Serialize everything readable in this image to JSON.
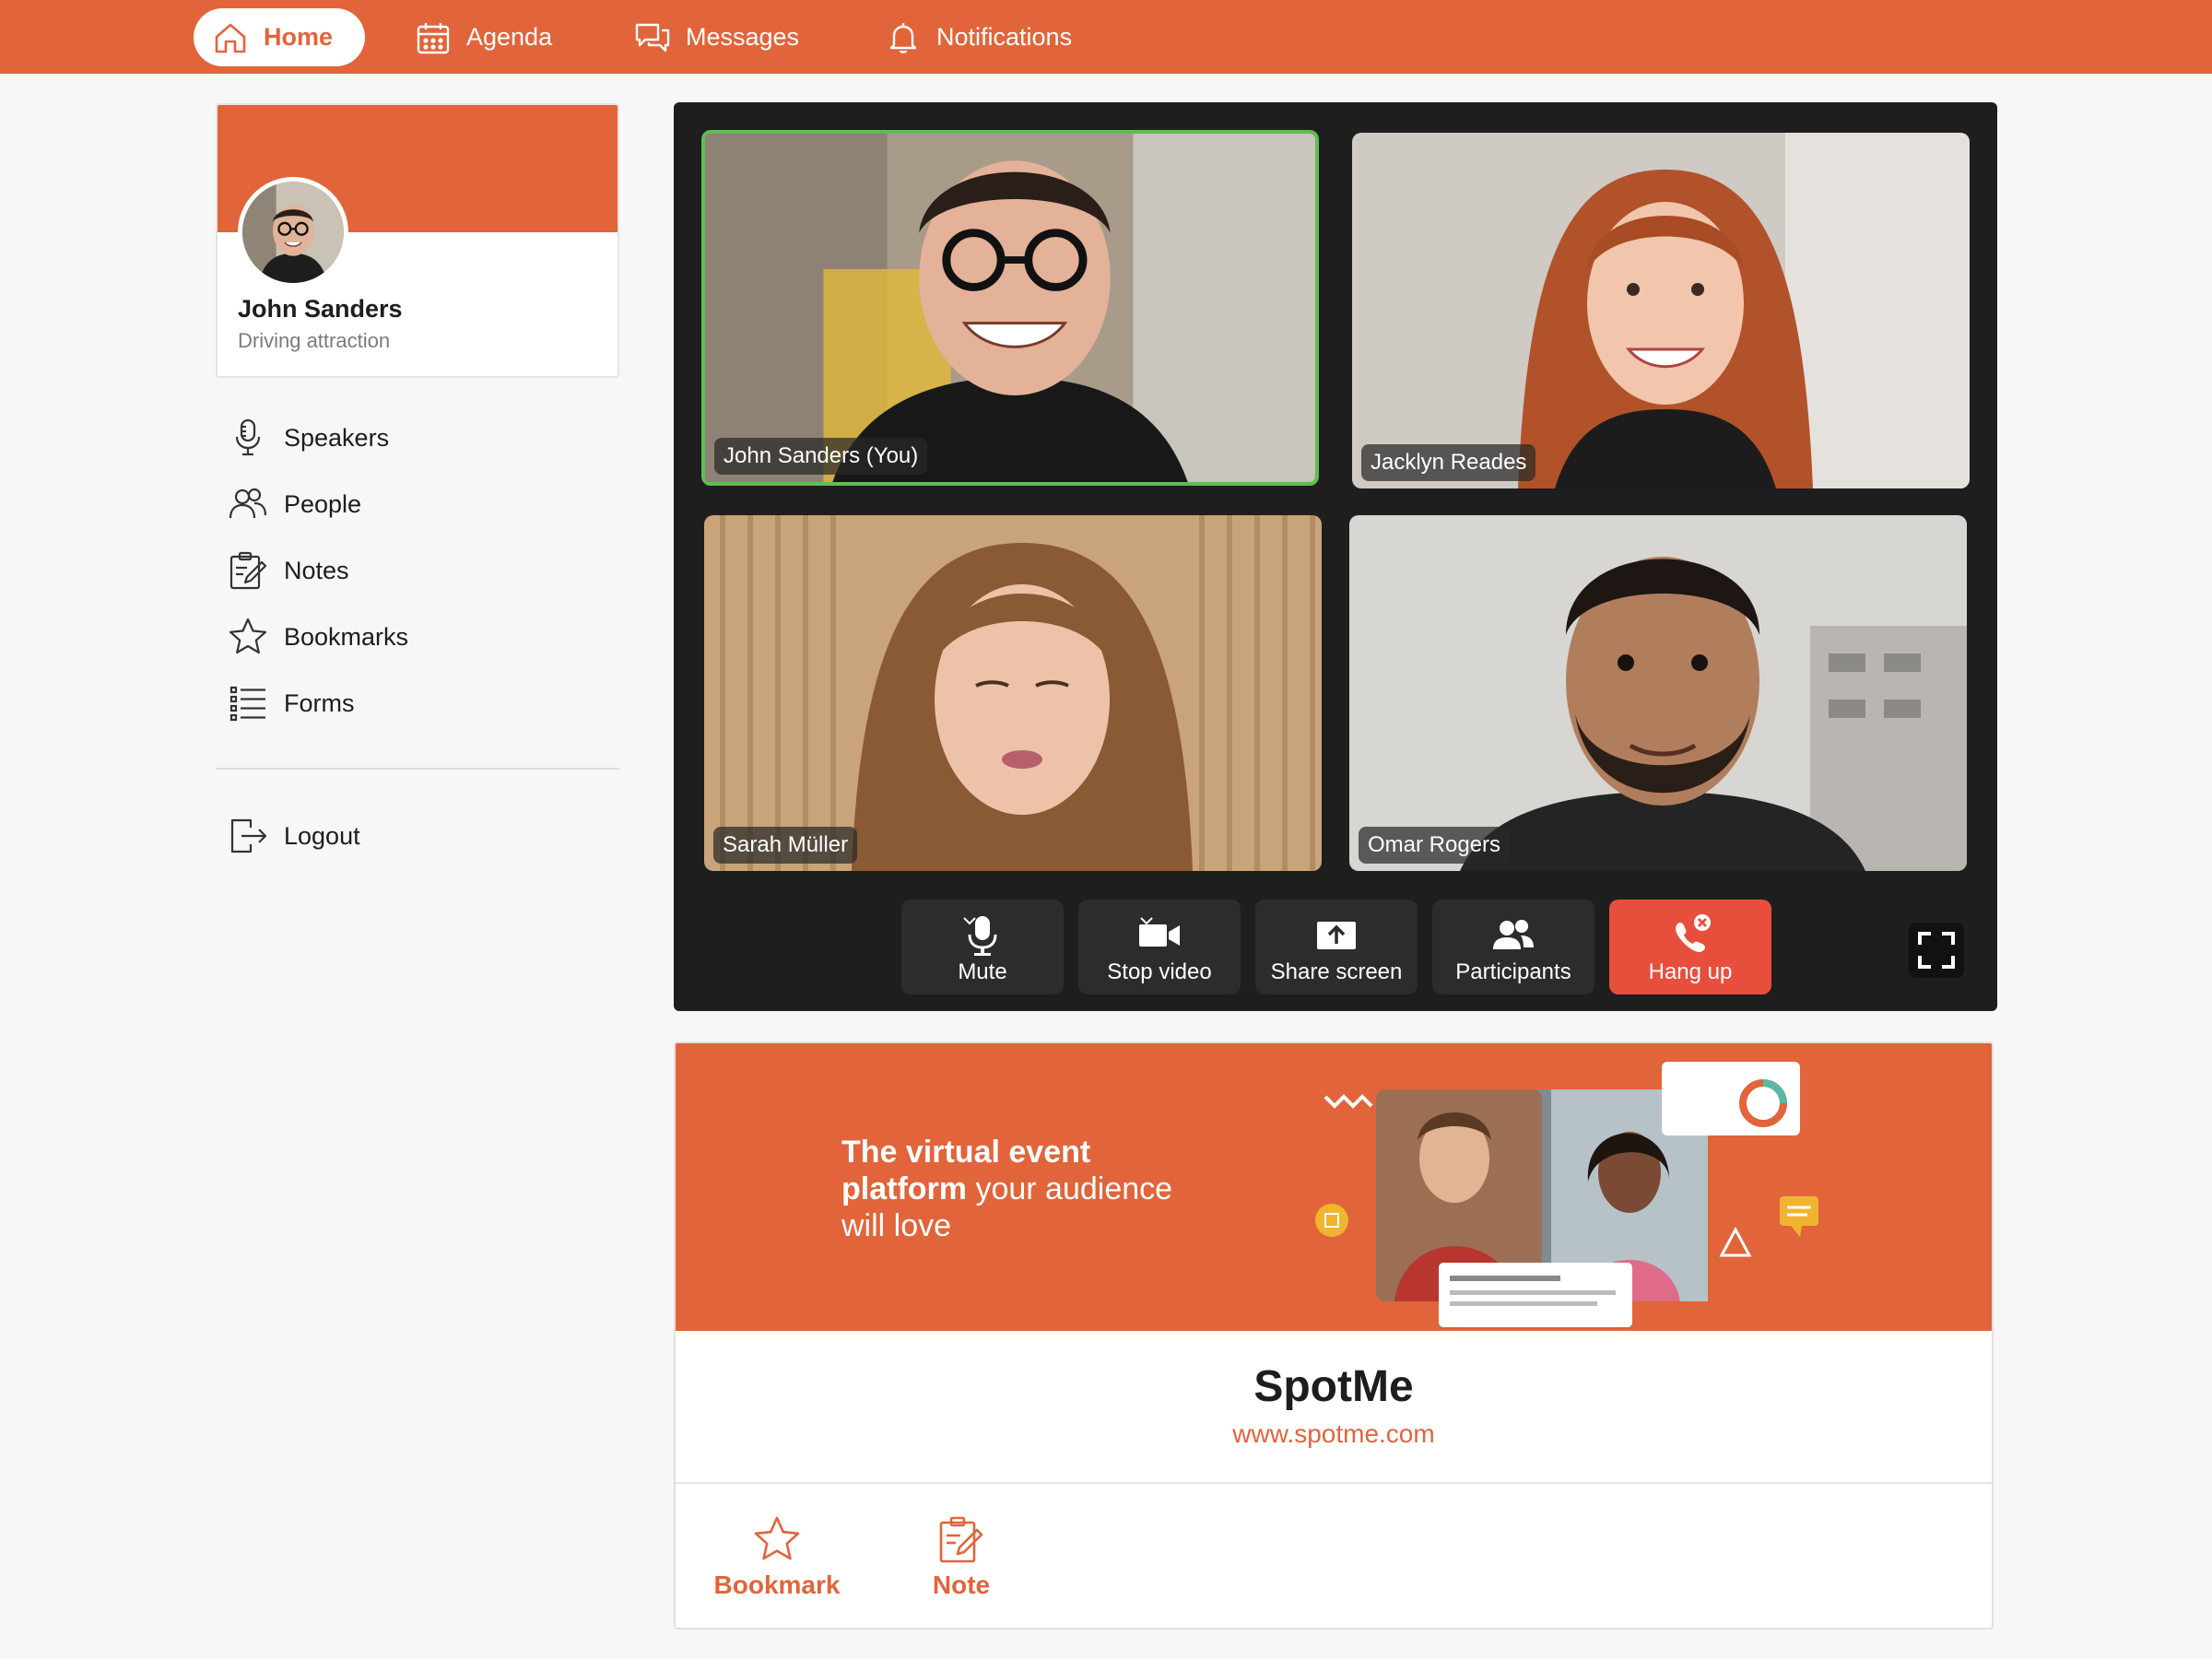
{
  "nav": {
    "home": "Home",
    "agenda": "Agenda",
    "messages": "Messages",
    "notifications": "Notifications"
  },
  "profile": {
    "name": "John Sanders",
    "role": "Driving attraction"
  },
  "menu": {
    "speakers": "Speakers",
    "people": "People",
    "notes": "Notes",
    "bookmarks": "Bookmarks",
    "forms": "Forms",
    "logout": "Logout"
  },
  "call": {
    "participants": [
      {
        "label": "John Sanders (You)",
        "active": true
      },
      {
        "label": "Jacklyn Reades",
        "active": false
      },
      {
        "label": "Sarah Müller",
        "active": false
      },
      {
        "label": "Omar Rogers",
        "active": false
      }
    ],
    "controls": {
      "mute": "Mute",
      "stop_video": "Stop video",
      "share_screen": "Share screen",
      "participants": "Participants",
      "hang_up": "Hang up"
    }
  },
  "sponsor": {
    "banner_bold_1": "The virtual event",
    "banner_bold_2": "platform",
    "banner_rest_1": " your audience",
    "banner_rest_2": "will love",
    "name": "SpotMe",
    "url": "www.spotme.com",
    "actions": {
      "bookmark": "Bookmark",
      "note": "Note"
    }
  },
  "colors": {
    "accent": "#e2643a",
    "hang_up": "#e84e3c",
    "active_speaker": "#5fbd55",
    "video_panel": "#1e1e1e"
  }
}
